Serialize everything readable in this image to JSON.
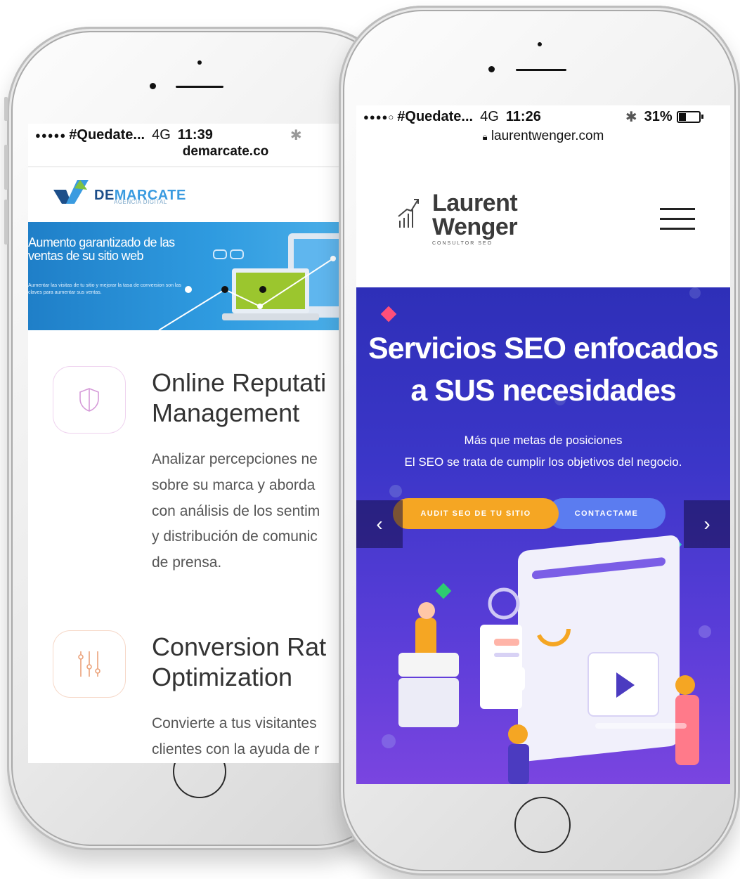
{
  "left_phone": {
    "status": {
      "signal": "●●●●●",
      "carrier": "#Quedate...",
      "network": "4G",
      "time": "11:39",
      "url": "demarcate.co"
    },
    "logo": {
      "part1": "DE",
      "part2": "MARCATE",
      "subtitle": "AGENCIA DIGITAL"
    },
    "banner": {
      "headline": "Aumento garantizado de las ventas de su sitio web",
      "text": "Aumentar las visitas de tu sitio y mejorar la tasa de conversion son las claves para aumentar sus ventas."
    },
    "services": [
      {
        "title_line1": "Online Reputati",
        "title_line2": "Management",
        "desc_lines": [
          "Analizar percepciones ne",
          "sobre su marca y aborda",
          "con análisis de los sentim",
          "y distribución de comunic",
          "de prensa."
        ]
      },
      {
        "title_line1": "Conversion Rat",
        "title_line2": "Optimization",
        "desc_lines": [
          "Convierte a tus visitantes",
          "clientes con la ayuda de r"
        ]
      }
    ]
  },
  "right_phone": {
    "status": {
      "signal": "●●●●○",
      "carrier": "#Quedate...",
      "network": "4G",
      "time": "11:26",
      "battery": "31%",
      "url": "laurentwenger.com"
    },
    "logo": {
      "line1": "Laurent",
      "line2": "Wenger",
      "subtitle": "CONSULTOR SEO"
    },
    "hero": {
      "title_line1": "Servicios SEO enfocados",
      "title_line2": "a SUS necesidades",
      "sub_line1": "Más que metas de posiciones",
      "sub_line2": "El SEO se trata de cumplir los objetivos del negocio.",
      "btn_audit": "AUDIT SEO DE TU SITIO",
      "btn_contact": "CONTACTAME",
      "prev": "‹",
      "next": "›"
    }
  },
  "colors": {
    "accent_orange": "#f5a623",
    "accent_blue": "#5b7cf0",
    "hero_purple": "#3b36c8",
    "banner_blue": "#2f9be0"
  }
}
